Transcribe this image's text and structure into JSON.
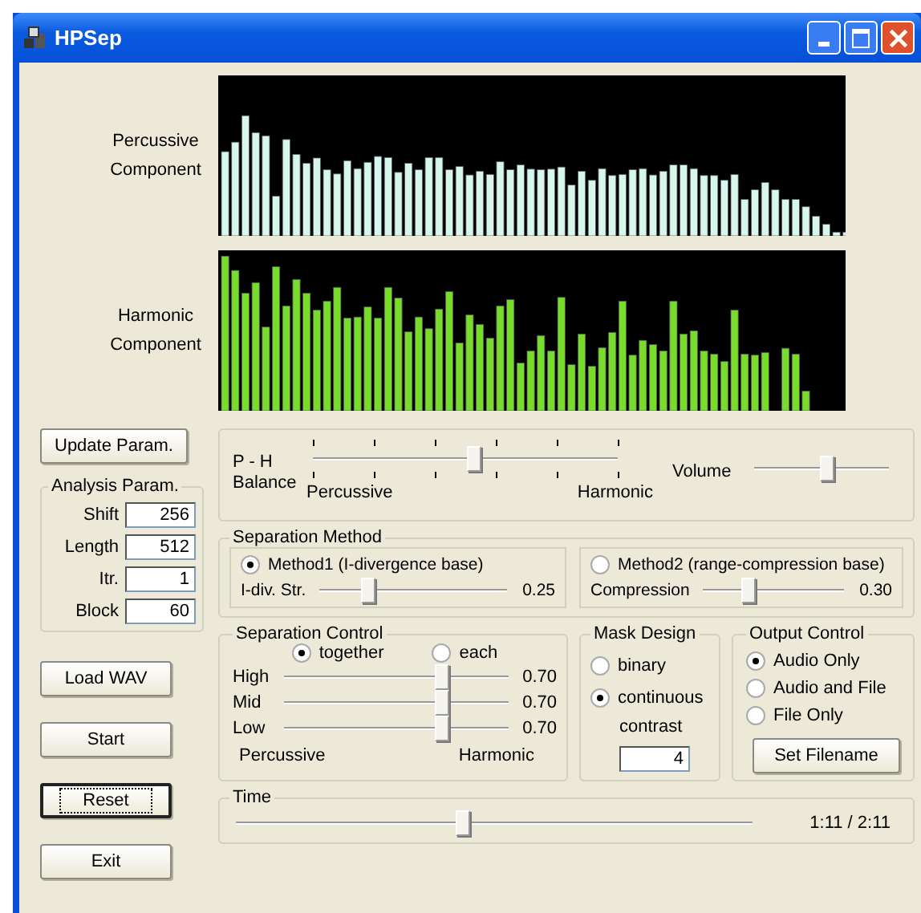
{
  "window": {
    "title": "HPSep"
  },
  "displays": [
    {
      "kind": "percussive",
      "label": "Percussive Component"
    },
    {
      "kind": "harmonic",
      "label": "Harmonic Component"
    }
  ],
  "update_button": "Update Param.",
  "analysis_params": {
    "title": "Analysis Param.",
    "fields": [
      {
        "label": "Shift",
        "value": "256"
      },
      {
        "label": "Length",
        "value": "512"
      },
      {
        "label": "Itr.",
        "value": "1"
      },
      {
        "label": "Block",
        "value": "60"
      }
    ]
  },
  "action_buttons": [
    {
      "label": "Load WAV",
      "focused": false
    },
    {
      "label": "Start",
      "focused": false
    },
    {
      "label": "Reset",
      "focused": true
    },
    {
      "label": "Exit",
      "focused": false
    }
  ],
  "balance": {
    "label": "P - H\nBalance",
    "level": 0.53,
    "left_label": "Percussive",
    "right_label": "Harmonic"
  },
  "volume": {
    "label": "Volume",
    "level": 0.55
  },
  "separation_method": {
    "title": "Separation Method",
    "methods": [
      {
        "label": "Method1 (I-divergence base)",
        "selected": true,
        "slider_label": "I-div. Str.",
        "level": 0.27,
        "reading": "0.25"
      },
      {
        "label": "Method2 (range-compression base)",
        "selected": false,
        "slider_label": "Compression",
        "level": 0.33,
        "reading": "0.30"
      }
    ]
  },
  "separation_control": {
    "title": "Separation Control",
    "modes": [
      {
        "label": "together",
        "selected": true
      },
      {
        "label": "each",
        "selected": false
      }
    ],
    "bands": [
      {
        "label": "High",
        "level": 0.71,
        "reading": "0.70"
      },
      {
        "label": "Mid",
        "level": 0.71,
        "reading": "0.70"
      },
      {
        "label": "Low",
        "level": 0.71,
        "reading": "0.70"
      }
    ],
    "left_label": "Percussive",
    "right_label": "Harmonic"
  },
  "mask_design": {
    "title": "Mask Design",
    "options": [
      {
        "label": "binary",
        "selected": false
      },
      {
        "label": "continuous",
        "selected": true
      }
    ],
    "contrast_label": "contrast",
    "contrast_value": "4"
  },
  "output_control": {
    "title": "Output Control",
    "options": [
      {
        "label": "Audio Only",
        "selected": true
      },
      {
        "label": "Audio and File",
        "selected": false
      },
      {
        "label": "File Only",
        "selected": false
      }
    ],
    "button": "Set Filename"
  },
  "time": {
    "title": "Time",
    "level": 0.44,
    "reading": "1:11 / 2:11"
  }
}
